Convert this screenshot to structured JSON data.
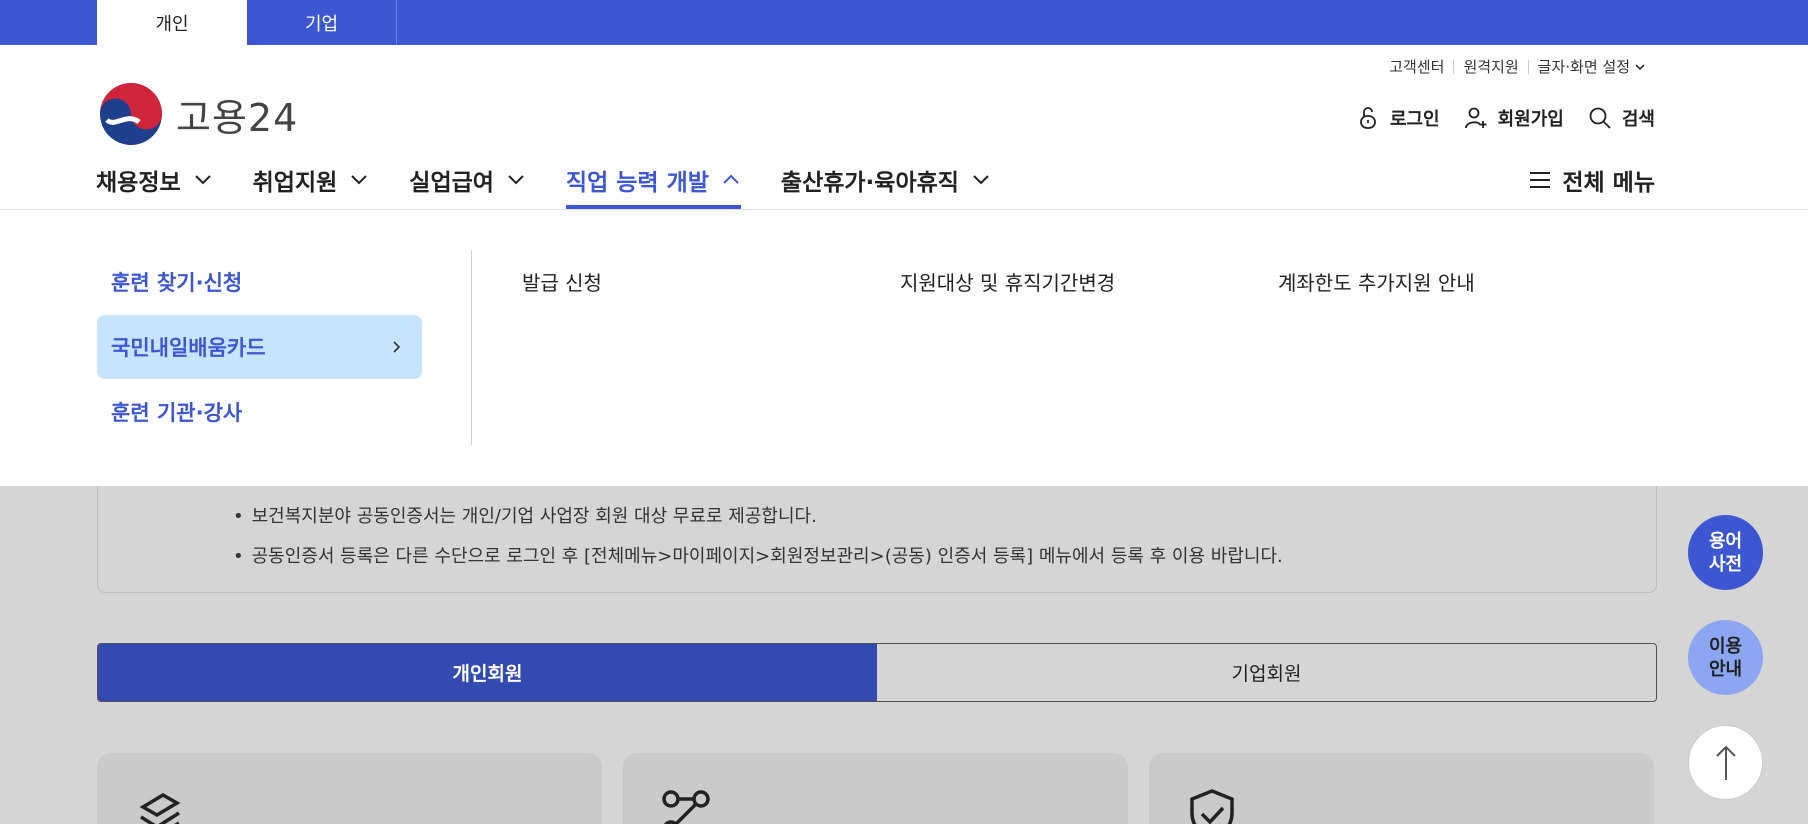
{
  "top_tabs": [
    "개인",
    "기업"
  ],
  "logo": {
    "text": "고용24"
  },
  "utils": {
    "items": [
      "고객센터",
      "원격지원",
      "글자·화면 설정"
    ]
  },
  "actions": {
    "login": "로그인",
    "signup": "회원가입",
    "search": "검색"
  },
  "gnb": {
    "items": [
      "채용정보",
      "취업지원",
      "실업급여",
      "직업 능력 개발",
      "출산휴가·육아휴직"
    ],
    "active_index": 3,
    "all_menu": "전체 메뉴"
  },
  "mega_menu": {
    "level1": [
      "훈련 찾기·신청",
      "국민내일배움카드",
      "훈련 기관·강사"
    ],
    "active_level1": 1,
    "level2": [
      "발급 신청",
      "지원대상 및 휴직기간변경",
      "계좌한도 추가지원 안내"
    ]
  },
  "notice": {
    "lines": [
      "보건복지분야 공동인증서는 개인/기업 사업장 회원 대상 무료로 제공합니다.",
      "공동인증서 등록은 다른 수단으로 로그인 후 [전체메뉴>마이페이지>회원정보관리>(공동) 인증서 등록] 메뉴에서 등록 후 이용 바랍니다."
    ]
  },
  "member_tabs": [
    "개인회원",
    "기업회원"
  ],
  "floating": {
    "dictionary": [
      "용어",
      "사전"
    ],
    "guide": [
      "이용",
      "안내"
    ]
  },
  "colors": {
    "primary": "#3d57d3",
    "tab_active": "#334ab0",
    "submenu_active": "#c6e5fc",
    "guide_button": "#8da6f2"
  },
  "icons": [
    "lock-icon",
    "user-plus-icon",
    "search-icon",
    "hamburger-icon",
    "chevron-down-icon",
    "chevron-up-icon",
    "chevron-right-icon",
    "layers-icon",
    "nodes-icon",
    "shield-check-icon",
    "arrow-up-icon"
  ]
}
